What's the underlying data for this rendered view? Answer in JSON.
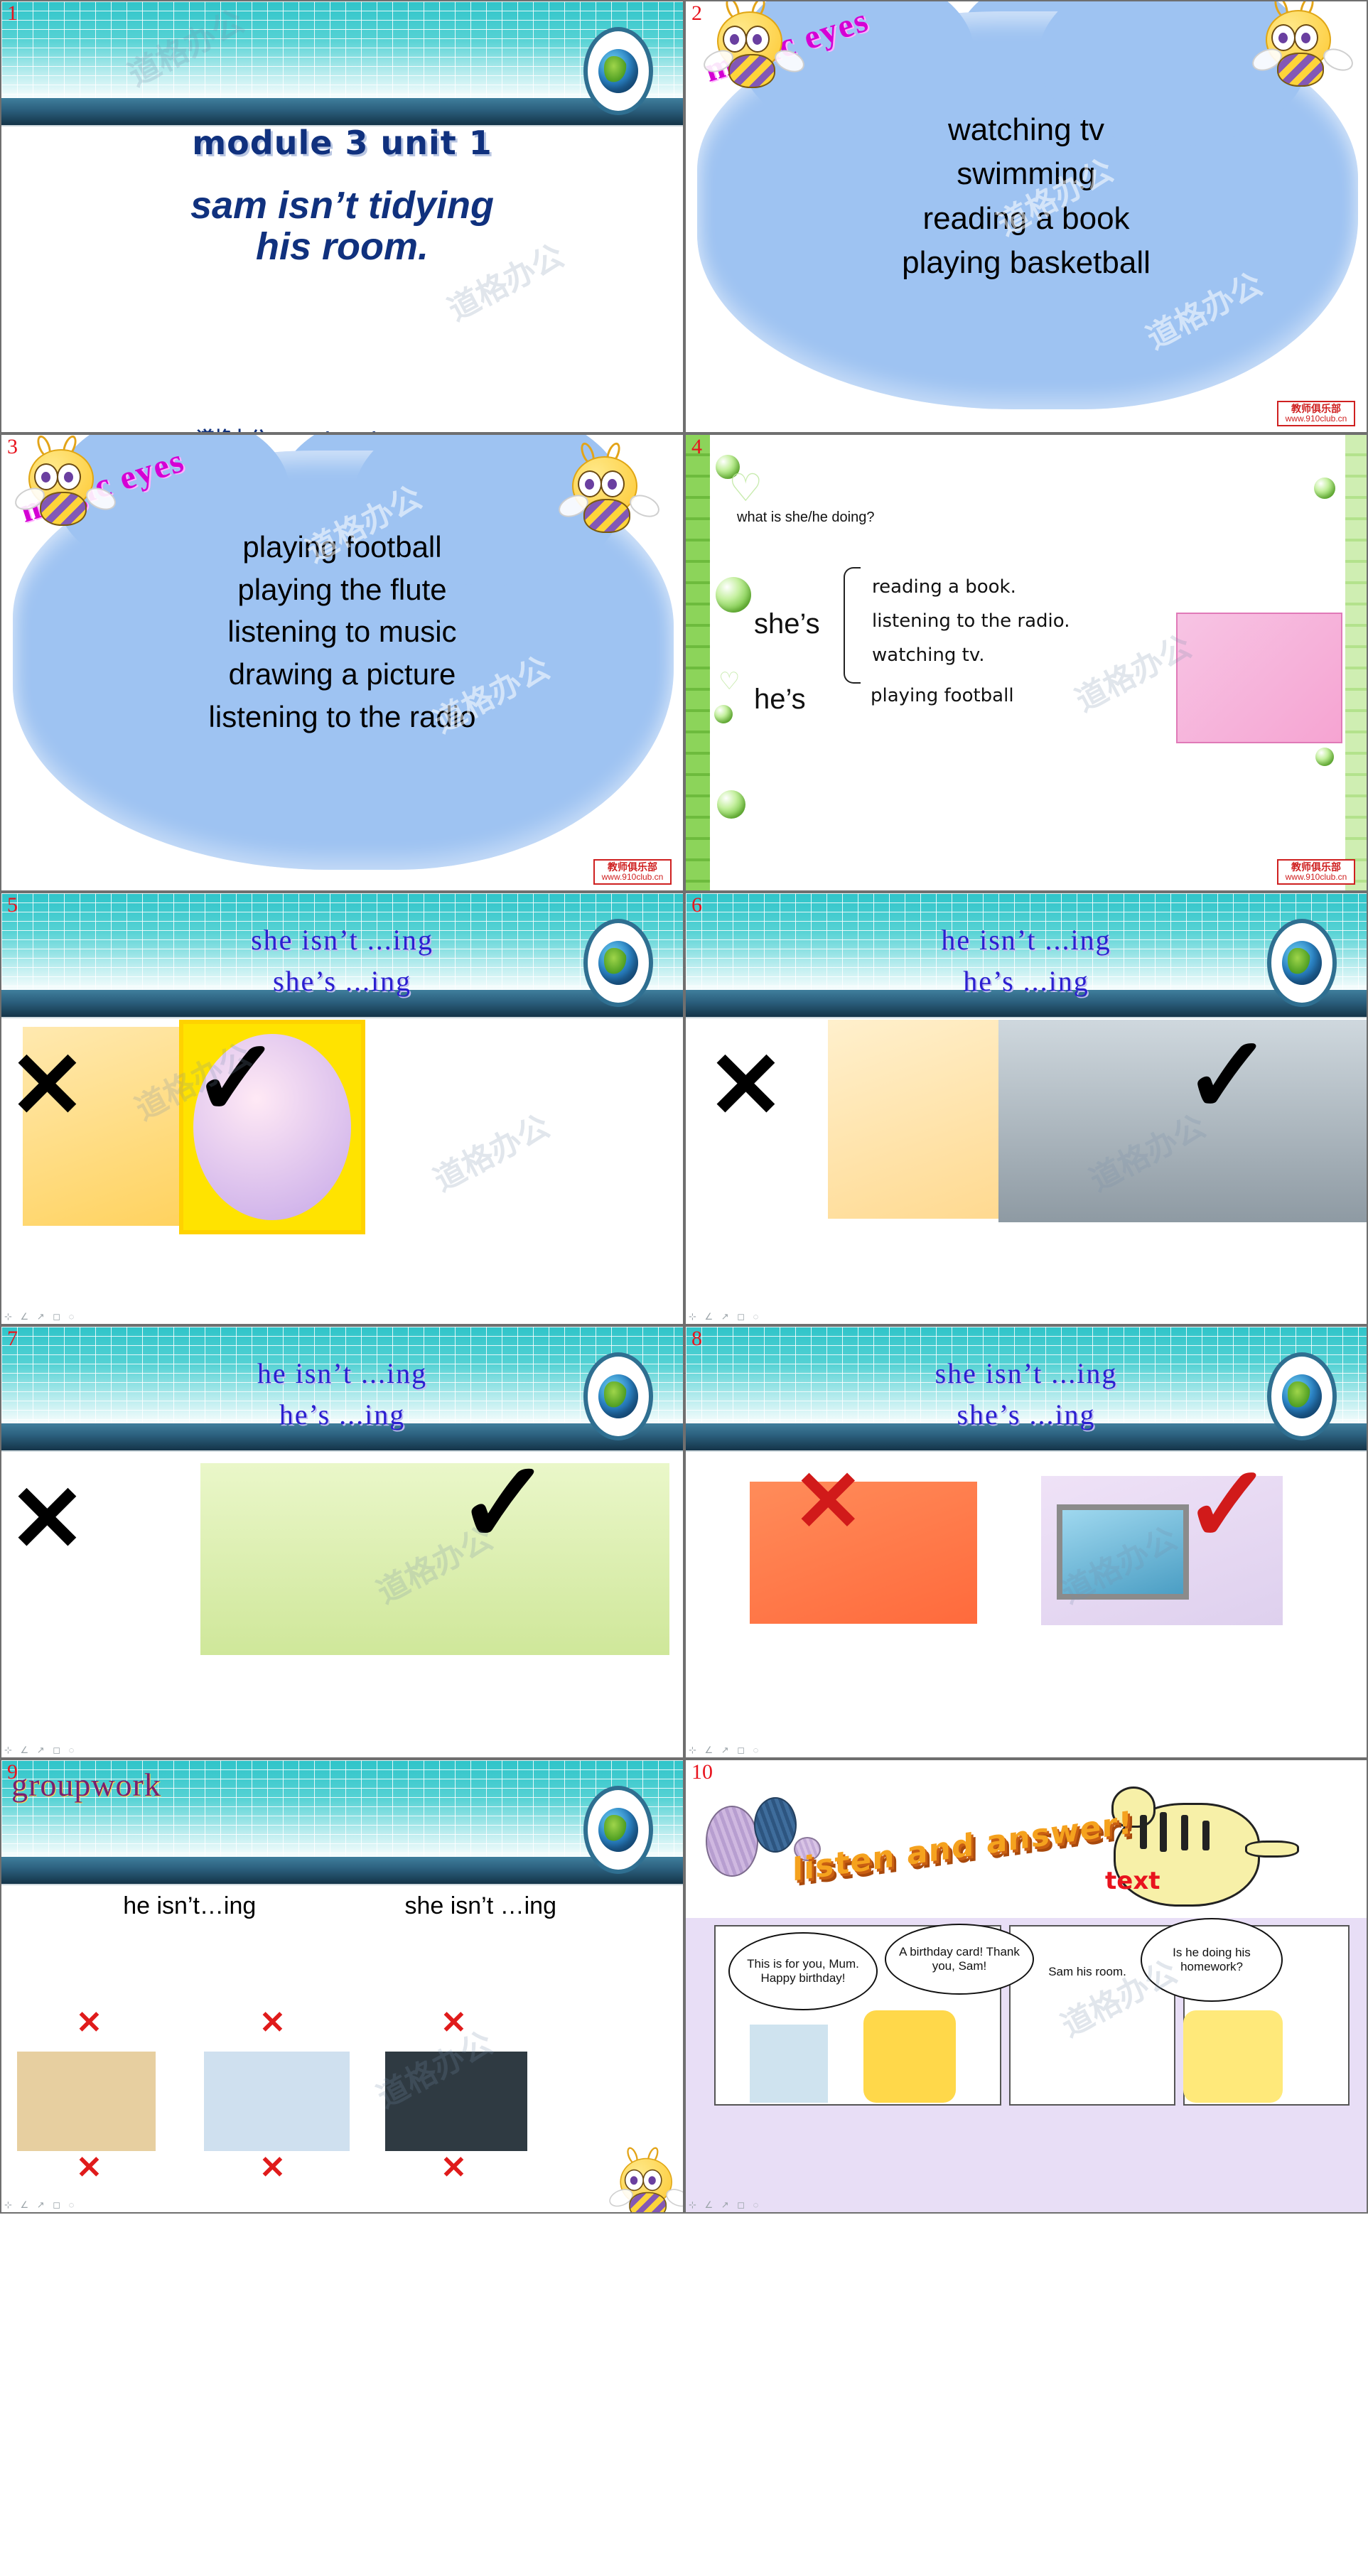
{
  "deck": {
    "watermark_text": "道格办公",
    "club_box": {
      "cn": "教师俱乐部",
      "url": "www.910club.cn"
    }
  },
  "slides": [
    {
      "number": "1",
      "name": "title-slide",
      "title": "module 3 unit 1",
      "subtitle_line1": "sam isn’t tidying",
      "subtitle_line2": "his room.",
      "url": "道格办公-www.daogebangong.com"
    },
    {
      "number": "2",
      "name": "magic-eyes-slide-a",
      "heading": "magic eyes",
      "items": [
        "watching tv",
        "swimming",
        "reading a book",
        "playing basketball"
      ]
    },
    {
      "number": "3",
      "name": "magic-eyes-slide-b",
      "heading": "magic eyes",
      "items": [
        "playing football",
        "playing the flute",
        "listening to music",
        "drawing a picture",
        "listening to the radio"
      ]
    },
    {
      "number": "4",
      "name": "what-is-she-he-doing-slide",
      "question": "what is she/he doing?",
      "subject_she": "she’s",
      "subject_he": "he’s",
      "she_options": [
        "reading a book.",
        "listening to the radio.",
        "watching tv."
      ],
      "he_option": "playing football"
    },
    {
      "number": "5",
      "name": "she-practice-slide-a",
      "line1": "she isn’t ...ing",
      "line2": "she’s ...ing",
      "mark_wrong": "✕",
      "mark_right": "✓"
    },
    {
      "number": "6",
      "name": "he-practice-slide-a",
      "line1": "he isn’t ...ing",
      "line2": "he’s ...ing",
      "mark_wrong": "✕",
      "mark_right": "✓"
    },
    {
      "number": "7",
      "name": "he-practice-slide-b",
      "line1": "he isn’t ...ing",
      "line2": "he’s ...ing",
      "mark_wrong": "✕",
      "mark_right": "✓"
    },
    {
      "number": "8",
      "name": "she-practice-slide-b",
      "line1": "she isn’t ...ing",
      "line2": "she’s ...ing",
      "mark_wrong": "✕",
      "mark_right": "✓"
    },
    {
      "number": "9",
      "name": "groupwork-slide",
      "heading": "groupwork",
      "col1": "he isn’t…ing",
      "col2": "she isn’t …ing",
      "mark_wrong": "✕"
    },
    {
      "number": "10",
      "name": "listen-and-answer-slide",
      "heading": "listen and answer!",
      "text_label": "text",
      "bubbles": [
        "This is for you, Mum. Happy birthday!",
        "A birthday card! Thank you, Sam!",
        "Sam his room.",
        "Is he doing his homework?"
      ]
    }
  ],
  "toolbar": {
    "glyphs": "⊹ ∠ ↗ ◻ ◌"
  }
}
